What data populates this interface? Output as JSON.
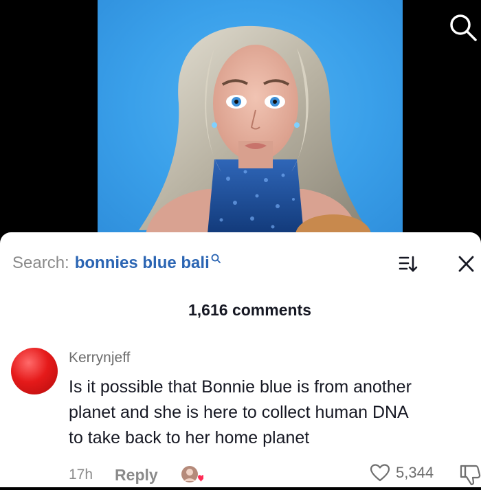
{
  "search": {
    "prefix": "Search:",
    "query": "bonnies blue bali",
    "query_icon": "search-icon"
  },
  "header_icons": {
    "top_search": "search-icon",
    "sort": "sort-icon",
    "close": "close-icon"
  },
  "comments_count": "1,616 comments",
  "comment": {
    "username": "Kerrynjeff",
    "lines": [
      "Is it possible that Bonnie blue is from another",
      "planet and she is here to collect human DNA",
      "to take back to her home planet"
    ],
    "time": "17h",
    "reply_label": "Reply",
    "likes": "5,344",
    "avatar_color": "#e51a1a"
  },
  "colors": {
    "query": "#2b65b3",
    "background_blue": "#3aa0ea",
    "creator_like_heart": "#fe2c55"
  }
}
